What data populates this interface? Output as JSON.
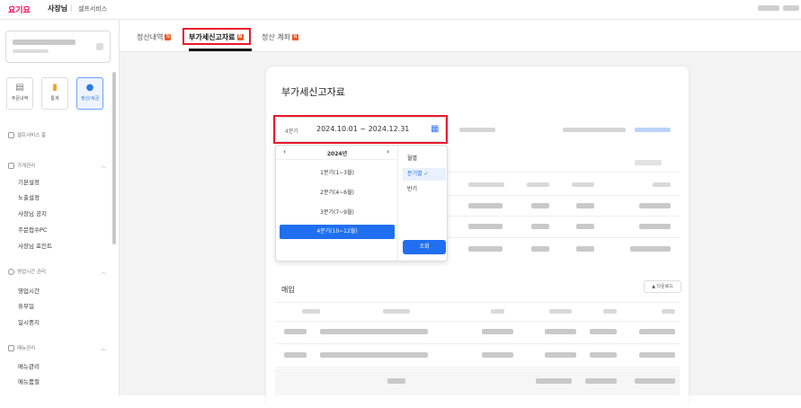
{
  "header": {
    "brand": "요기요",
    "brand_sub": "사장님",
    "separator": "|",
    "service": "셀프서비스"
  },
  "sidebar": {
    "quick_links": [
      {
        "label": "주문내역",
        "icon": "receipt-icon"
      },
      {
        "label": "통계",
        "icon": "bar-chart-icon"
      },
      {
        "label": "정산/세금",
        "icon": "money-bag-icon",
        "active": true
      }
    ],
    "home": "셀프서비스 홈",
    "sections": [
      {
        "title": "가게관리",
        "items": [
          "기본설정",
          "노출설정",
          "사장님 공지",
          "주문접수PC",
          "사장님 포인트"
        ]
      },
      {
        "title": "영업시간 관리",
        "items": [
          "영업시간",
          "휴무일",
          "일시중지"
        ]
      },
      {
        "title": "메뉴관리",
        "items": [
          "메뉴관리",
          "메뉴품절"
        ]
      }
    ]
  },
  "tabs": [
    {
      "label": "정산내역",
      "badge": "N"
    },
    {
      "label": "부가세신고자료",
      "badge": "N",
      "active": true
    },
    {
      "label": "정산 계좌",
      "badge": "N"
    }
  ],
  "card": {
    "title": "부가세신고자료",
    "date_filter": {
      "quarter_label": "4분기",
      "range": "2024.10.01 ~ 2024.12.31"
    },
    "dropdown": {
      "year": "2024년",
      "prev": "‹",
      "next": "›",
      "quarters": [
        "1분기(1~3월)",
        "2분기(4~6월)",
        "3분기(7~9월)",
        "4분기(10~12월)"
      ],
      "selected_quarter": 3,
      "periods": [
        "월별",
        "분기별 ✓",
        "반기"
      ],
      "selected_period": 1,
      "query_button": "조회"
    },
    "purchase_section": "매입",
    "download_button": "▲ 다운로드"
  },
  "colors": {
    "brand": "#fa0050",
    "accent": "#1f6ff0",
    "highlight": "#e8192c"
  }
}
